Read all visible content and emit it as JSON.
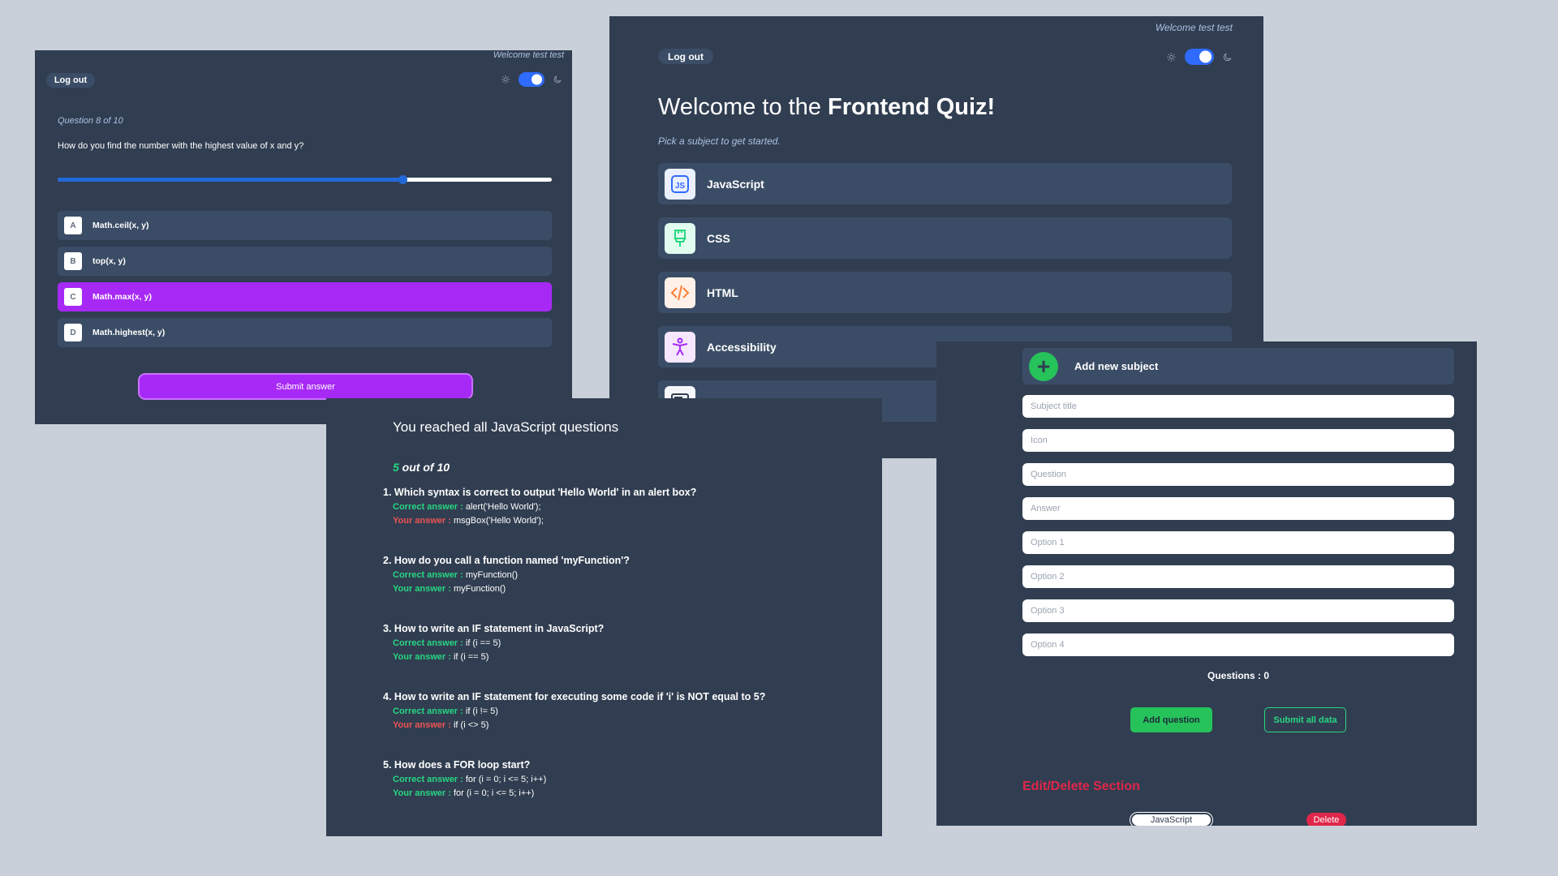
{
  "quiz_panel": {
    "welcome": "Welcome test test",
    "logout_label": "Log out",
    "question_count": "Question 8 of 10",
    "question": "How do you find the number with the highest value of x and y?",
    "progress_fraction": 0.7,
    "options": [
      {
        "letter": "A",
        "text": "Math.ceil(x, y)",
        "selected": false
      },
      {
        "letter": "B",
        "text": "top(x, y)",
        "selected": false
      },
      {
        "letter": "C",
        "text": "Math.max(x, y)",
        "selected": true
      },
      {
        "letter": "D",
        "text": "Math.highest(x, y)",
        "selected": false
      }
    ],
    "submit_label": "Submit answer"
  },
  "home_panel": {
    "welcome": "Welcome test test",
    "logout_label": "Log out",
    "title_prefix": "Welcome to the ",
    "title_bold": "Frontend Quiz!",
    "subtitle": "Pick a subject to get started.",
    "subjects": [
      {
        "label": "JavaScript",
        "icon": "js-icon",
        "icon_bg": "#ebf0ff"
      },
      {
        "label": "CSS",
        "icon": "brush-icon",
        "icon_bg": "#e0fdef"
      },
      {
        "label": "HTML",
        "icon": "code-icon",
        "icon_bg": "#fff1e9"
      },
      {
        "label": "Accessibility",
        "icon": "accessibility-icon",
        "icon_bg": "#f6e7ff"
      },
      {
        "label": "",
        "icon": "monitor-icon",
        "icon_bg": "#f4f6fa"
      }
    ]
  },
  "results_panel": {
    "title": "You reached all JavaScript questions",
    "score": "5",
    "score_suffix": " out of 10",
    "correct_label": "Correct answer : ",
    "your_label": "Your answer : ",
    "results": [
      {
        "n": "1.",
        "q": "Which syntax is correct to output 'Hello World' in an alert box?",
        "correct": "alert('Hello World');",
        "yours": "msgBox('Hello World');",
        "is_correct": false
      },
      {
        "n": "2.",
        "q": "How do you call a function named 'myFunction'?",
        "correct": "myFunction()",
        "yours": "myFunction()",
        "is_correct": true
      },
      {
        "n": "3.",
        "q": "How to write an IF statement in JavaScript?",
        "correct": "if (i == 5)",
        "yours": "if (i == 5)",
        "is_correct": true
      },
      {
        "n": "4.",
        "q": "How to write an IF statement for executing some code if 'i' is NOT equal to 5?",
        "correct": "if (i != 5)",
        "yours": "if (i <> 5)",
        "is_correct": false
      },
      {
        "n": "5.",
        "q": "How does a FOR loop start?",
        "correct": "for (i = 0; i <= 5; i++)",
        "yours": "for (i = 0; i <= 5; i++)",
        "is_correct": true
      }
    ]
  },
  "admin_panel": {
    "add_label": "Add new subject",
    "fields": [
      "Subject title",
      "Icon",
      "Question",
      "Answer",
      "Option 1",
      "Option 2",
      "Option 3",
      "Option 4"
    ],
    "questions_count": "Questions : 0",
    "add_question_label": "Add question",
    "submit_all_label": "Submit all data",
    "edit_title": "Edit/Delete Section",
    "subject_chip": "JavaScript",
    "delete_label": "Delete"
  },
  "colors": {
    "page_bg": "#c9d0d9",
    "panel_bg": "#313e51",
    "card_bg": "#3b4d66",
    "purple": "#a729f5",
    "green": "#26d782",
    "red": "#ee5454"
  }
}
